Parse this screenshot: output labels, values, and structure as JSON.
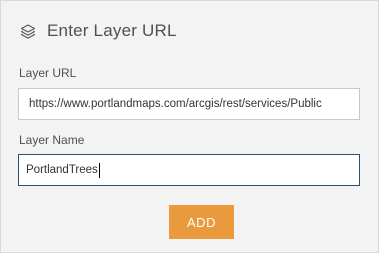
{
  "header": {
    "icon": "layers-icon",
    "title": "Enter Layer URL"
  },
  "form": {
    "url_label": "Layer URL",
    "url_value": "https://www.portlandmaps.com/arcgis/rest/services/Public",
    "name_label": "Layer Name",
    "name_value": "PortlandTrees"
  },
  "actions": {
    "add_label": "ADD"
  },
  "colors": {
    "accent": "#e89a3c",
    "focus_border": "#2b4d78",
    "panel_bg": "#f3f3f3"
  }
}
